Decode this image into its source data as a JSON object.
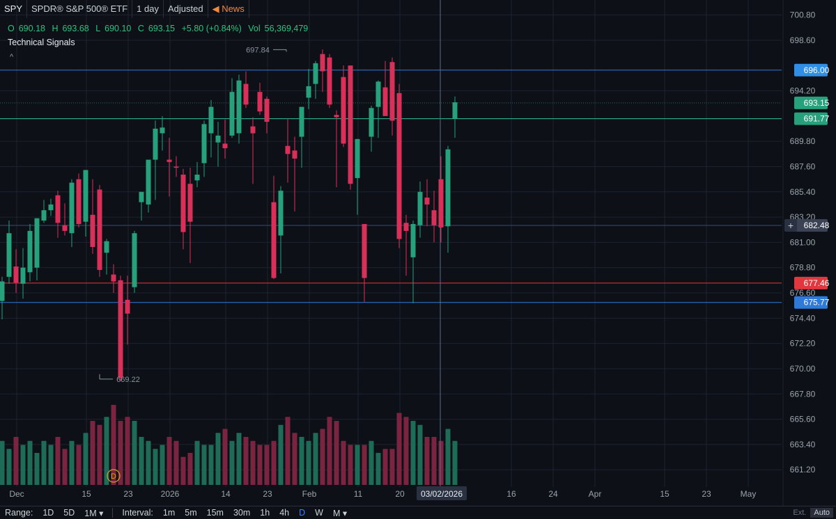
{
  "header": {
    "symbol": "SPY",
    "name": "SPDR® S&P 500® ETF",
    "interval": "1 day",
    "adjusted": "Adjusted",
    "news": "News"
  },
  "ohlc": {
    "o_label": "O",
    "o": "690.18",
    "h_label": "H",
    "h": "693.68",
    "l_label": "L",
    "l": "690.10",
    "c_label": "C",
    "c": "693.15",
    "change": "+5.80 (+0.84%)",
    "vol_label": "Vol",
    "vol": "56,369,479"
  },
  "technical_signals": "Technical Signals",
  "bottom": {
    "range_label": "Range:",
    "ranges": [
      "1D",
      "5D",
      "1M ▾"
    ],
    "interval_label": "Interval:",
    "intervals": [
      "1m",
      "5m",
      "15m",
      "30m",
      "1h",
      "4h",
      "D",
      "W",
      "M ▾"
    ],
    "active_interval": "D",
    "ext": "Ext.",
    "auto": "Auto"
  },
  "colors": {
    "up": "#26a17b",
    "down": "#d9305a",
    "up_vol": "#1e6b57",
    "down_vol": "#7a2440",
    "background": "#0d1117",
    "grid": "#1c2230",
    "blue_line": "#2f7ad6",
    "teal_line": "#2ec2a0",
    "red_line": "#e0383e",
    "crosshair": "#5a6a8a"
  },
  "chart_data": {
    "type": "candlestick",
    "ylim": [
      659.7,
      701.5
    ],
    "y_ticks": [
      "700.80",
      "698.60",
      "694.20",
      "689.80",
      "687.60",
      "685.40",
      "683.20",
      "681.00",
      "678.80",
      "676.60",
      "674.40",
      "672.20",
      "670.00",
      "667.80",
      "665.60",
      "663.40",
      "661.20"
    ],
    "x_ticks": [
      "Dec",
      "15",
      "23",
      "2026",
      "14",
      "23",
      "Feb",
      "11",
      "20",
      "16",
      "24",
      "Apr",
      "15",
      "23",
      "May"
    ],
    "crosshair_date": "03/02/2026",
    "high_label": "697.84",
    "low_label": "669.22",
    "price_labels": [
      {
        "value": "696.00",
        "color": "#2f8fe6"
      },
      {
        "value": "693.15",
        "color": "#26a17b"
      },
      {
        "value": "691.77",
        "color": "#26a17b"
      },
      {
        "value": "682.48",
        "color": "#3a4253"
      },
      {
        "value": "677.46",
        "color": "#e0383e"
      },
      {
        "value": "675.77",
        "color": "#2f7ad6"
      }
    ],
    "horizontal_lines": [
      {
        "price": 696.0,
        "color": "#2f7ad6"
      },
      {
        "price": 691.77,
        "color": "#2ec2a0"
      },
      {
        "price": 682.48,
        "color": "#3a4a66"
      },
      {
        "price": 677.46,
        "color": "#e0383e"
      },
      {
        "price": 675.77,
        "color": "#2f7ad6"
      }
    ],
    "candles": [
      {
        "o": 675.9,
        "h": 678.0,
        "l": 674.3,
        "c": 677.6
      },
      {
        "o": 678.0,
        "h": 682.9,
        "l": 677.4,
        "c": 681.8
      },
      {
        "o": 678.9,
        "h": 680.4,
        "l": 676.6,
        "c": 677.5
      },
      {
        "o": 677.4,
        "h": 680.5,
        "l": 676.1,
        "c": 678.8
      },
      {
        "o": 678.4,
        "h": 682.6,
        "l": 677.6,
        "c": 682.0
      },
      {
        "o": 678.8,
        "h": 683.1,
        "l": 677.7,
        "c": 683.1
      },
      {
        "o": 682.9,
        "h": 684.7,
        "l": 682.7,
        "c": 683.8
      },
      {
        "o": 683.8,
        "h": 684.8,
        "l": 683.3,
        "c": 684.3
      },
      {
        "o": 685.1,
        "h": 685.5,
        "l": 681.4,
        "c": 682.7
      },
      {
        "o": 682.5,
        "h": 684.4,
        "l": 681.6,
        "c": 682.0
      },
      {
        "o": 681.8,
        "h": 686.5,
        "l": 680.6,
        "c": 686.2
      },
      {
        "o": 686.5,
        "h": 687.0,
        "l": 682.3,
        "c": 682.6
      },
      {
        "o": 682.8,
        "h": 687.3,
        "l": 681.5,
        "c": 687.3
      },
      {
        "o": 683.4,
        "h": 686.5,
        "l": 680.0,
        "c": 680.6
      },
      {
        "o": 685.6,
        "h": 686.0,
        "l": 678.0,
        "c": 678.6
      },
      {
        "o": 680.1,
        "h": 681.3,
        "l": 678.2,
        "c": 681.1
      },
      {
        "o": 678.2,
        "h": 679.1,
        "l": 676.6,
        "c": 677.6
      },
      {
        "o": 677.7,
        "h": 678.1,
        "l": 668.9,
        "c": 669.2
      },
      {
        "o": 676.0,
        "h": 678.1,
        "l": 672.1,
        "c": 674.8
      },
      {
        "o": 677.1,
        "h": 682.0,
        "l": 676.6,
        "c": 681.8
      },
      {
        "o": 684.5,
        "h": 685.3,
        "l": 682.9,
        "c": 685.4
      },
      {
        "o": 684.3,
        "h": 686.5,
        "l": 683.6,
        "c": 688.2
      },
      {
        "o": 688.2,
        "h": 691.6,
        "l": 684.7,
        "c": 690.9
      },
      {
        "o": 690.5,
        "h": 692.0,
        "l": 689.0,
        "c": 691.0
      },
      {
        "o": 688.2,
        "h": 690.1,
        "l": 685.0,
        "c": 688.0
      },
      {
        "o": 687.6,
        "h": 688.5,
        "l": 686.7,
        "c": 687.5
      },
      {
        "o": 686.9,
        "h": 687.4,
        "l": 680.4,
        "c": 681.9
      },
      {
        "o": 686.1,
        "h": 687.5,
        "l": 679.2,
        "c": 682.8
      },
      {
        "o": 686.4,
        "h": 688.0,
        "l": 685.8,
        "c": 686.9
      },
      {
        "o": 687.9,
        "h": 691.6,
        "l": 686.7,
        "c": 691.3
      },
      {
        "o": 690.5,
        "h": 693.4,
        "l": 688.4,
        "c": 692.8
      },
      {
        "o": 689.7,
        "h": 691.5,
        "l": 687.6,
        "c": 690.3
      },
      {
        "o": 689.6,
        "h": 691.7,
        "l": 688.3,
        "c": 689.2
      },
      {
        "o": 690.3,
        "h": 695.3,
        "l": 690.1,
        "c": 694.1
      },
      {
        "o": 690.5,
        "h": 695.6,
        "l": 689.6,
        "c": 695.1
      },
      {
        "o": 694.8,
        "h": 695.9,
        "l": 692.7,
        "c": 693.0
      },
      {
        "o": 691.1,
        "h": 691.9,
        "l": 686.1,
        "c": 690.5
      },
      {
        "o": 694.1,
        "h": 694.9,
        "l": 692.1,
        "c": 692.4
      },
      {
        "o": 693.5,
        "h": 693.7,
        "l": 690.5,
        "c": 691.5
      },
      {
        "o": 684.5,
        "h": 686.8,
        "l": 677.8,
        "c": 677.9
      },
      {
        "o": 681.6,
        "h": 685.9,
        "l": 678.3,
        "c": 685.5
      },
      {
        "o": 689.4,
        "h": 691.8,
        "l": 686.2,
        "c": 688.7
      },
      {
        "o": 689.0,
        "h": 690.2,
        "l": 683.7,
        "c": 688.3
      },
      {
        "o": 690.2,
        "h": 692.0,
        "l": 687.5,
        "c": 692.8
      },
      {
        "o": 693.6,
        "h": 696.1,
        "l": 692.6,
        "c": 694.6
      },
      {
        "o": 694.8,
        "h": 696.8,
        "l": 693.5,
        "c": 696.6
      },
      {
        "o": 697.4,
        "h": 697.8,
        "l": 694.1,
        "c": 695.9
      },
      {
        "o": 697.1,
        "h": 697.4,
        "l": 692.7,
        "c": 693.0
      },
      {
        "o": 692.1,
        "h": 692.5,
        "l": 685.8,
        "c": 691.9
      },
      {
        "o": 695.4,
        "h": 696.4,
        "l": 689.3,
        "c": 689.6
      },
      {
        "o": 696.4,
        "h": 696.4,
        "l": 685.6,
        "c": 686.1
      },
      {
        "o": 686.6,
        "h": 690.0,
        "l": 683.4,
        "c": 690.0
      },
      {
        "o": 682.6,
        "h": 682.6,
        "l": 675.8,
        "c": 677.9
      },
      {
        "o": 690.2,
        "h": 692.9,
        "l": 688.9,
        "c": 692.7
      },
      {
        "o": 692.8,
        "h": 695.1,
        "l": 690.1,
        "c": 695.0
      },
      {
        "o": 694.5,
        "h": 696.8,
        "l": 692.2,
        "c": 692.0
      },
      {
        "o": 696.7,
        "h": 697.1,
        "l": 690.3,
        "c": 691.6
      },
      {
        "o": 694.0,
        "h": 694.8,
        "l": 680.5,
        "c": 681.3
      },
      {
        "o": 682.7,
        "h": 683.4,
        "l": 678.1,
        "c": 682.0
      },
      {
        "o": 679.7,
        "h": 682.9,
        "l": 675.7,
        "c": 682.6
      },
      {
        "o": 682.5,
        "h": 686.3,
        "l": 681.4,
        "c": 685.4
      },
      {
        "o": 684.9,
        "h": 686.5,
        "l": 682.4,
        "c": 684.3
      },
      {
        "o": 683.8,
        "h": 685.5,
        "l": 681.0,
        "c": 682.5
      },
      {
        "o": 686.5,
        "h": 688.5,
        "l": 681.0,
        "c": 682.3
      },
      {
        "o": 682.4,
        "h": 689.4,
        "l": 680.1,
        "c": 689.1
      },
      {
        "o": 691.8,
        "h": 693.7,
        "l": 690.1,
        "c": 693.2
      }
    ],
    "volume_relative": [
      0.55,
      0.45,
      0.6,
      0.5,
      0.55,
      0.4,
      0.55,
      0.5,
      0.6,
      0.45,
      0.55,
      0.5,
      0.65,
      0.8,
      0.75,
      0.85,
      1.0,
      0.8,
      0.85,
      0.8,
      0.6,
      0.55,
      0.45,
      0.5,
      0.6,
      0.55,
      0.35,
      0.4,
      0.55,
      0.5,
      0.5,
      0.65,
      0.7,
      0.55,
      0.65,
      0.6,
      0.55,
      0.5,
      0.5,
      0.55,
      0.75,
      0.85,
      0.65,
      0.6,
      0.55,
      0.65,
      0.7,
      0.85,
      0.8,
      0.55,
      0.5,
      0.5,
      0.5,
      0.55,
      0.4,
      0.45,
      0.45,
      0.9,
      0.85,
      0.8,
      0.75,
      0.6,
      0.6,
      0.55,
      0.7,
      0.55
    ]
  }
}
